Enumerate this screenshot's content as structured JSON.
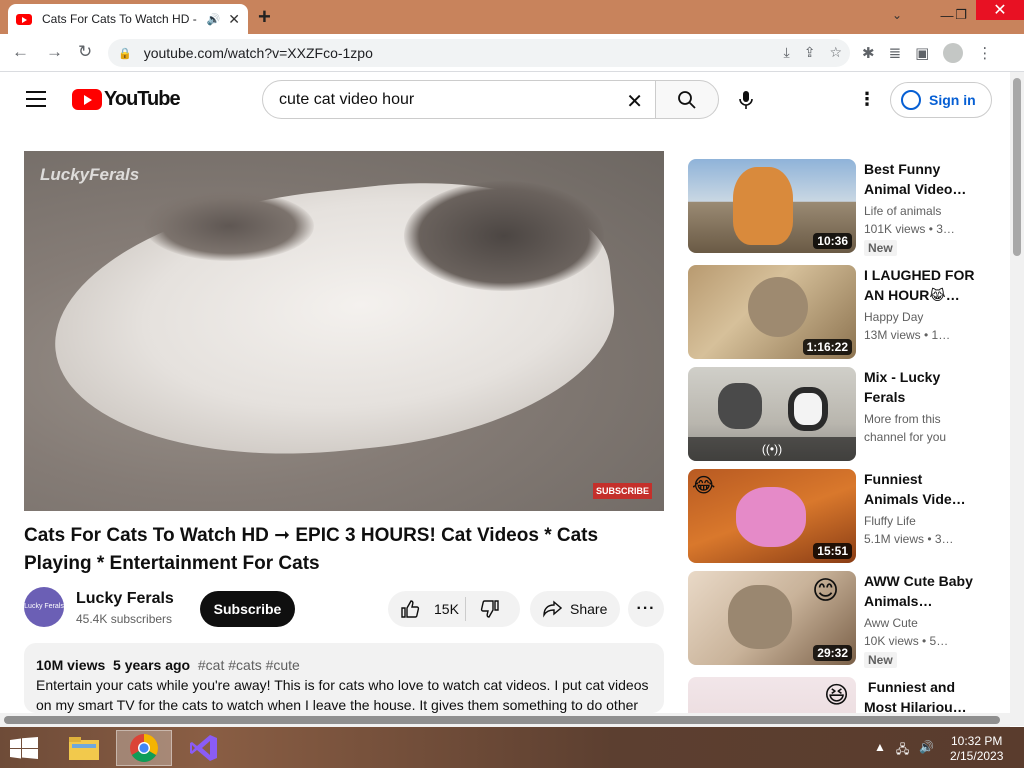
{
  "browser": {
    "tab_title": "Cats For Cats To Watch HD -",
    "url": "youtube.com/watch?v=XXZFco-1zpo"
  },
  "youtube": {
    "logo_text": "YouTube",
    "search_value": "cute cat video hour",
    "signin_label": "Sign in"
  },
  "video": {
    "watermark": "LuckyFerals",
    "subscribe_badge": "SUBSCRIBE",
    "title": "Cats For Cats To Watch HD ➞ EPIC 3 HOURS! Cat Videos * Cats Playing * Entertainment For Cats",
    "channel_avatar_text": "Lucky Ferals",
    "channel": "Lucky Ferals",
    "subscribers": "45.4K subscribers",
    "subscribe_label": "Subscribe",
    "likes": "15K",
    "share_label": "Share",
    "views": "10M views",
    "age": "5 years ago",
    "tags": "#cat #cats #cute",
    "description": "Entertain your cats while you're away! This is for cats who love to watch cat videos. I put cat videos on my smart TV for the cats to watch when I leave the house. It gives them something to do other"
  },
  "recommendations": [
    {
      "title": "Best Funny Animal Video…",
      "channel": "Life of animals",
      "meta": "101K views • 3…",
      "duration": "10:36",
      "badge": "New"
    },
    {
      "title": "I LAUGHED FOR AN HOUR😹…",
      "channel": "Happy Day",
      "meta": "13M views • 1…",
      "duration": "1:16:22",
      "badge": ""
    },
    {
      "title": "Mix - Lucky Ferals",
      "channel": "More from this",
      "meta": "channel for you",
      "duration": "",
      "badge": "",
      "mix_icon": "((•))"
    },
    {
      "title": "Funniest Animals Vide…",
      "channel": "Fluffy Life",
      "meta": "5.1M views • 3…",
      "duration": "15:51",
      "badge": ""
    },
    {
      "title": "AWW Cute Baby Animals…",
      "channel": "Aww Cute",
      "meta": "10K views • 5…",
      "duration": "29:32",
      "badge": "New"
    },
    {
      "title": "󠁿 Funniest and Most Hilariou…",
      "channel": "",
      "meta": "",
      "duration": "",
      "badge": ""
    }
  ],
  "taskbar": {
    "time": "10:32 PM",
    "date": "2/15/2023"
  },
  "colors": {
    "accent_red": "#ff0000",
    "link_blue": "#065fd4",
    "chrome_frame": "#c8835c"
  }
}
